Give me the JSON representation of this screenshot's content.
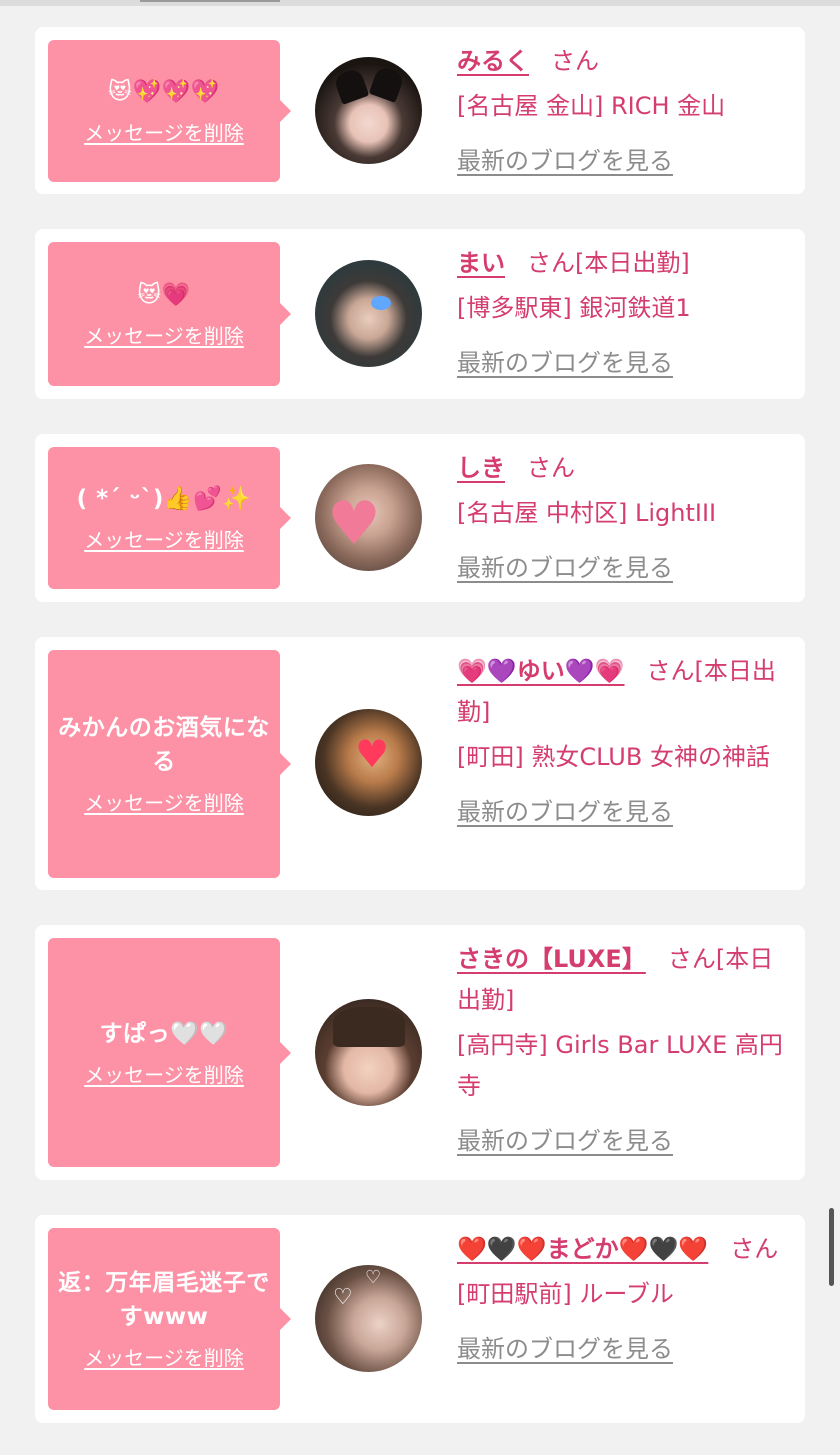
{
  "delete_label": "メッセージを削除",
  "blog_label": "最新のブログを見る",
  "cards": [
    {
      "message": "😻💖💖💖",
      "name": "みるく",
      "suffix": "さん",
      "shop": "[名古屋 金山] RICH 金山"
    },
    {
      "message": "😻💗",
      "name": "まい",
      "suffix": "さん[本日出勤]",
      "shop": "[博多駅東] 銀河鉄道1"
    },
    {
      "message": "( *´ ᵕ`)👍💕✨",
      "name": "しき",
      "suffix": "さん",
      "shop": "[名古屋 中村区] LightIII"
    },
    {
      "message": "みかんのお酒気になる",
      "name": "💗💜ゆい💜💗",
      "suffix": "さん[本日出勤]",
      "shop": "[町田] 熟女CLUB 女神の神話"
    },
    {
      "message": "すぱっ🤍🤍",
      "name": "さきの【LUXE】",
      "suffix": "さん[本日出勤]",
      "shop": "[高円寺] Girls Bar LUXE 高円寺"
    },
    {
      "message": "返：万年眉毛迷子ですwww",
      "name": "❤️🖤❤️まどか❤️🖤❤️",
      "suffix": "さん",
      "shop": "[町田駅前] ルーブル"
    }
  ],
  "colors": {
    "bubble": "#fd92a6",
    "accent": "#d43d6e",
    "link_gray": "#8c8c8c",
    "background": "#f1f1f1"
  }
}
